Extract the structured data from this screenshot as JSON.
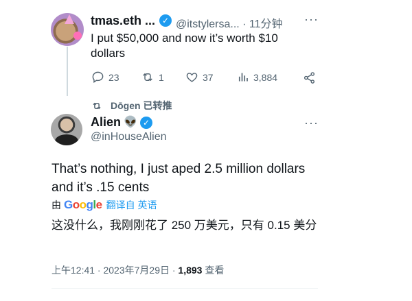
{
  "parent_tweet": {
    "display_name": "tmas.eth ...",
    "handle": "@itstylersa...",
    "time": "· 11分钟",
    "text": "I put $50,000 and now it’s worth $10 dollars",
    "replies": "23",
    "retweets": "1",
    "likes": "37",
    "views": "3,884"
  },
  "retweet_context": {
    "text": "Dōgen 已转推"
  },
  "main_tweet": {
    "display_name": "Alien",
    "emoji": "👽",
    "handle": "@inHouseAlien",
    "text": "That’s nothing, I just aped 2.5 million dollars and it’s .15 cents",
    "translate_by": "由",
    "translate_link": "翻译自 英语",
    "translated_text": "这没什么，我刚刚花了 250 万美元，只有 0.15 美分",
    "timestamp": "上午12:41 · 2023年7月29日 ·",
    "view_count": "1,893",
    "view_label": "查看"
  },
  "colors": {
    "accent": "#1d9bf0",
    "muted": "#536471"
  }
}
